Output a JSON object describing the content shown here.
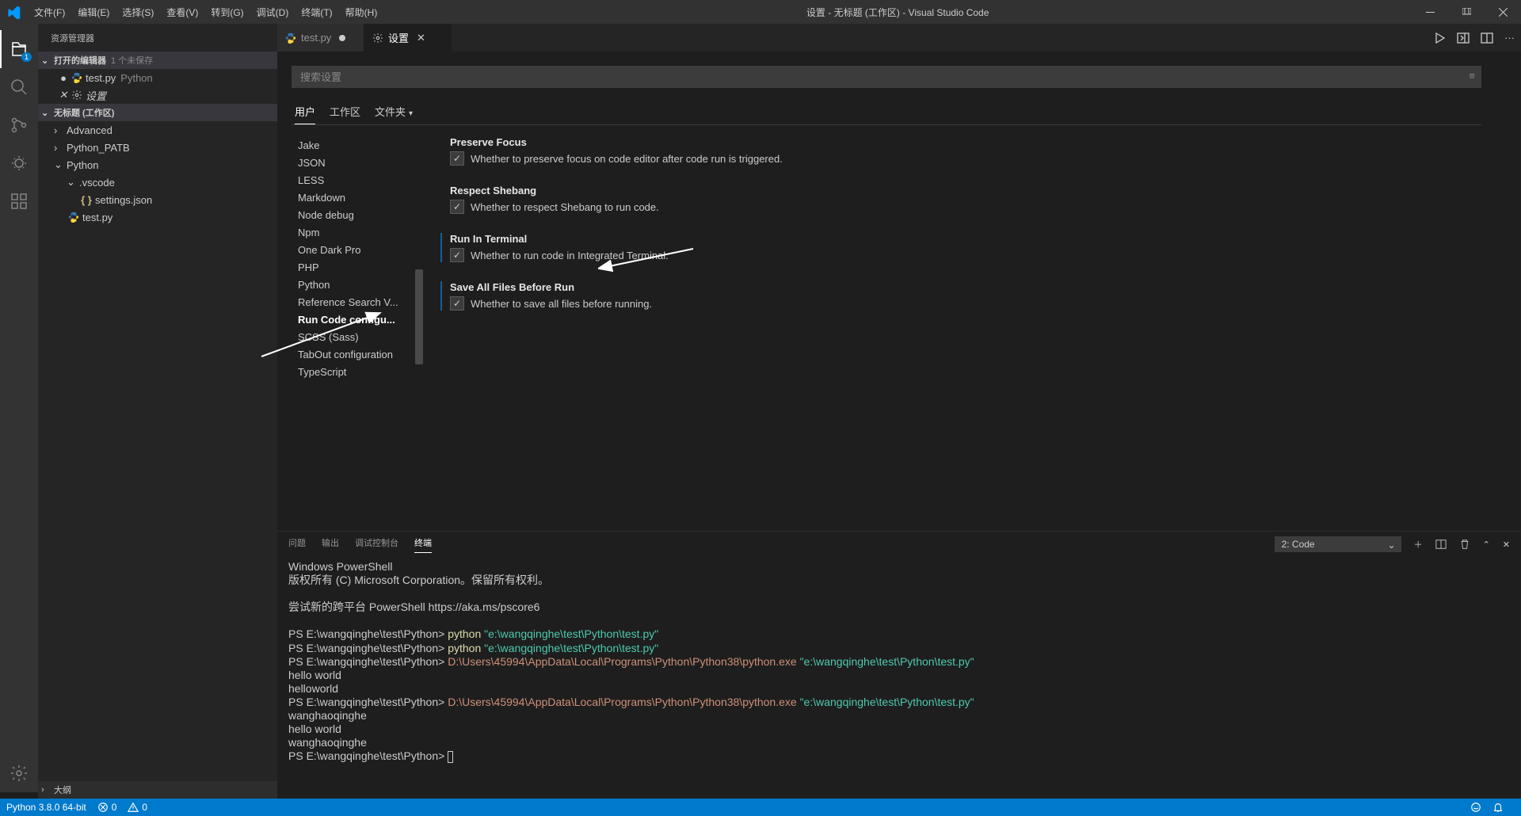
{
  "titlebar": {
    "menus": [
      "文件(F)",
      "编辑(E)",
      "选择(S)",
      "查看(V)",
      "转到(G)",
      "调试(D)",
      "终端(T)",
      "帮助(H)"
    ],
    "title": "设置 - 无标题 (工作区) - Visual Studio Code"
  },
  "activity": {
    "explorer_badge": "1"
  },
  "sidebar": {
    "header": "资源管理器",
    "openEditors": {
      "label": "打开的编辑器",
      "unsaved": "1 个未保存"
    },
    "openItems": [
      {
        "name": "test.py",
        "sub": "Python",
        "dirty": true
      },
      {
        "name": "设置",
        "italic": true,
        "close": true
      }
    ],
    "workspace": "无标题 (工作区)",
    "tree": [
      {
        "lvl": 1,
        "chev": "›",
        "name": "Advanced"
      },
      {
        "lvl": 1,
        "chev": "›",
        "name": "Python_PATB"
      },
      {
        "lvl": 1,
        "chev": "⌄",
        "name": "Python"
      },
      {
        "lvl": 2,
        "chev": "⌄",
        "name": ".vscode"
      },
      {
        "lvl": 3,
        "icon": "braces",
        "name": "settings.json"
      },
      {
        "lvl": 2,
        "icon": "py",
        "name": "test.py"
      }
    ],
    "outline": "大纲"
  },
  "tabs": {
    "items": [
      {
        "icon": "py",
        "label": "test.py",
        "dirty": true
      },
      {
        "icon": "gear",
        "label": "设置",
        "active": true
      }
    ]
  },
  "settings": {
    "searchPlaceholder": "搜索设置",
    "scopes": {
      "user": "用户",
      "workspace": "工作区",
      "folder": "文件夹"
    },
    "toc": [
      "Jake",
      "JSON",
      "LESS",
      "Markdown",
      "Node debug",
      "Npm",
      "One Dark Pro",
      "PHP",
      "Python",
      "Reference Search V...",
      "Run Code configu...",
      "SCSS (Sass)",
      "TabOut configuration",
      "TypeScript"
    ],
    "tocActiveIndex": 10,
    "items": [
      {
        "title": "Preserve Focus",
        "desc": "Whether to preserve focus on code editor after code run is triggered.",
        "checked": true
      },
      {
        "title": "Respect Shebang",
        "desc": "Whether to respect Shebang to run code.",
        "checked": true
      },
      {
        "title": "Run In Terminal",
        "desc": "Whether to run code in Integrated Terminal.",
        "checked": true,
        "hl": true
      },
      {
        "title": "Save All Files Before Run",
        "desc": "Whether to save all files before running.",
        "checked": true,
        "hl": true
      }
    ]
  },
  "panel": {
    "tabs": [
      "问题",
      "输出",
      "调试控制台",
      "终端"
    ],
    "activeTab": 3,
    "terminalSelector": "2: Code",
    "lines": [
      {
        "segs": [
          {
            "t": "Windows PowerShell"
          }
        ]
      },
      {
        "segs": [
          {
            "t": "版权所有 (C) Microsoft Corporation。保留所有权利。"
          }
        ]
      },
      {
        "segs": [
          {
            "t": ""
          }
        ]
      },
      {
        "segs": [
          {
            "t": "尝试新的跨平台 PowerShell https://aka.ms/pscore6"
          }
        ]
      },
      {
        "segs": [
          {
            "t": ""
          }
        ]
      },
      {
        "segs": [
          {
            "t": "PS E:\\wangqinghe\\test\\Python> "
          },
          {
            "t": "python ",
            "c": "y"
          },
          {
            "t": "\"e:\\wangqinghe\\test\\Python\\test.py\"",
            "c": "c"
          }
        ]
      },
      {
        "segs": [
          {
            "t": "PS E:\\wangqinghe\\test\\Python> "
          },
          {
            "t": "python ",
            "c": "y"
          },
          {
            "t": "\"e:\\wangqinghe\\test\\Python\\test.py\"",
            "c": "c"
          }
        ]
      },
      {
        "segs": [
          {
            "t": "PS E:\\wangqinghe\\test\\Python> "
          },
          {
            "t": "D:\\Users\\45994\\AppData\\Local\\Programs\\Python\\Python38\\python.exe ",
            "c": "o"
          },
          {
            "t": "\"e:\\wangqinghe\\test\\Python\\test.py\"",
            "c": "c"
          }
        ]
      },
      {
        "segs": [
          {
            "t": "hello world"
          }
        ]
      },
      {
        "segs": [
          {
            "t": "helloworld"
          }
        ]
      },
      {
        "segs": [
          {
            "t": "PS E:\\wangqinghe\\test\\Python> "
          },
          {
            "t": "D:\\Users\\45994\\AppData\\Local\\Programs\\Python\\Python38\\python.exe ",
            "c": "o"
          },
          {
            "t": "\"e:\\wangqinghe\\test\\Python\\test.py\"",
            "c": "c"
          }
        ]
      },
      {
        "segs": [
          {
            "t": "wanghaoqinghe"
          }
        ]
      },
      {
        "segs": [
          {
            "t": "hello world"
          }
        ]
      },
      {
        "segs": [
          {
            "t": "wanghaoqinghe"
          }
        ]
      },
      {
        "segs": [
          {
            "t": "PS E:\\wangqinghe\\test\\Python> "
          },
          {
            "cursor": true
          }
        ]
      }
    ]
  },
  "status": {
    "python": "Python 3.8.0 64-bit",
    "errors": "0",
    "warnings": "0"
  }
}
